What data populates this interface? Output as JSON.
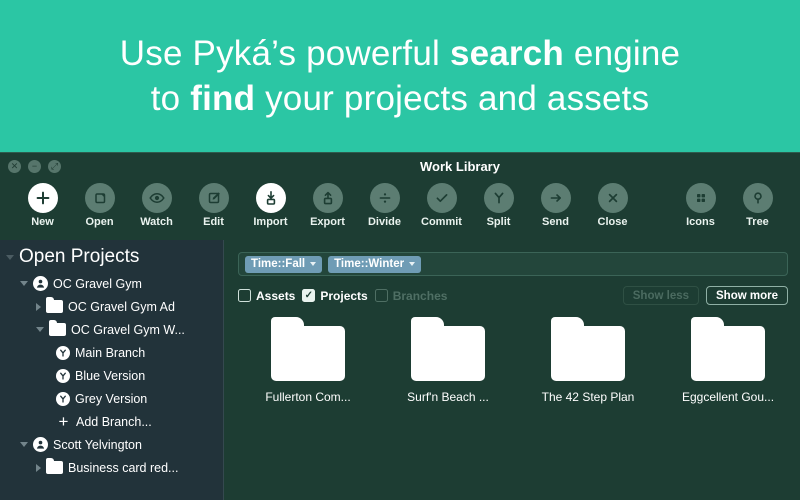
{
  "promo": {
    "line1_a": "Use Pyká’s powerful ",
    "line1_b": "search",
    "line1_c": " engine",
    "line2_a": "to ",
    "line2_b": "find",
    "line2_c": " your projects and assets",
    "background_color": "#2bc6a4"
  },
  "window": {
    "title": "Work Library",
    "traffic_lights": [
      {
        "name": "close",
        "glyph": "✕"
      },
      {
        "name": "minimize",
        "glyph": "−"
      },
      {
        "name": "zoom",
        "glyph": "⤢"
      }
    ]
  },
  "toolbar": {
    "items": [
      {
        "label": "New",
        "icon": "plus-icon",
        "active": true
      },
      {
        "label": "Open",
        "icon": "open-folder-icon",
        "active": false
      },
      {
        "label": "Watch",
        "icon": "eye-icon",
        "active": false
      },
      {
        "label": "Edit",
        "icon": "pencil-edit-icon",
        "active": false
      },
      {
        "label": "Import",
        "icon": "import-icon",
        "active": true
      },
      {
        "label": "Export",
        "icon": "export-icon",
        "active": false
      },
      {
        "label": "Divide",
        "icon": "divide-icon",
        "active": false
      },
      {
        "label": "Commit",
        "icon": "check-icon",
        "active": false
      },
      {
        "label": "Split",
        "icon": "branch-y-icon",
        "active": false
      },
      {
        "label": "Send",
        "icon": "arrow-right-icon",
        "active": false
      },
      {
        "label": "Close",
        "icon": "close-x-icon",
        "active": false
      }
    ],
    "right_items": [
      {
        "label": "Icons",
        "icon": "grid-view-icon",
        "active": false
      },
      {
        "label": "Tree",
        "icon": "tree-view-icon",
        "active": false
      }
    ]
  },
  "sidebar": {
    "root_label": "Open Projects",
    "items": [
      {
        "label": "OC Gravel Gym",
        "icon": "person-icon",
        "indent": 1,
        "twisty": "down"
      },
      {
        "label": "OC Gravel Gym Ad",
        "icon": "folder-icon",
        "indent": 2,
        "twisty": "right"
      },
      {
        "label": "OC Gravel Gym W...",
        "icon": "folder-icon",
        "indent": 2,
        "twisty": "down"
      },
      {
        "label": "Main Branch",
        "icon": "branch-icon",
        "indent": 3,
        "twisty": "none"
      },
      {
        "label": "Blue Version",
        "icon": "branch-icon",
        "indent": 3,
        "twisty": "none"
      },
      {
        "label": "Grey Version",
        "icon": "branch-icon",
        "indent": 3,
        "twisty": "none"
      },
      {
        "label": "Add Branch...",
        "icon": "plus-icon",
        "indent": 3,
        "twisty": "none"
      },
      {
        "label": "Scott Yelvington",
        "icon": "person-icon",
        "indent": 1,
        "twisty": "down"
      },
      {
        "label": "Business card red...",
        "icon": "folder-icon",
        "indent": 2,
        "twisty": "right"
      }
    ]
  },
  "search": {
    "tokens": [
      {
        "label": "Time::Fall",
        "color": "#6f9cb5"
      },
      {
        "label": "Time::Winter",
        "color": "#6f9cb5"
      }
    ],
    "placeholder": ""
  },
  "filters": {
    "checkboxes": [
      {
        "label": "Assets",
        "checked": false,
        "disabled": false
      },
      {
        "label": "Projects",
        "checked": true,
        "disabled": false
      },
      {
        "label": "Branches",
        "checked": false,
        "disabled": true
      }
    ],
    "check_glyph": "✓",
    "show_less_label": "Show less",
    "show_less_disabled": true,
    "show_more_label": "Show more",
    "show_more_disabled": false
  },
  "results": {
    "items": [
      {
        "label": "Fullerton Com...",
        "icon": "folder-icon"
      },
      {
        "label": "Surf'n Beach ...",
        "icon": "folder-icon"
      },
      {
        "label": "The 42 Step Plan",
        "icon": "folder-icon"
      },
      {
        "label": "Eggcellent Gou...",
        "icon": "folder-icon"
      }
    ]
  }
}
